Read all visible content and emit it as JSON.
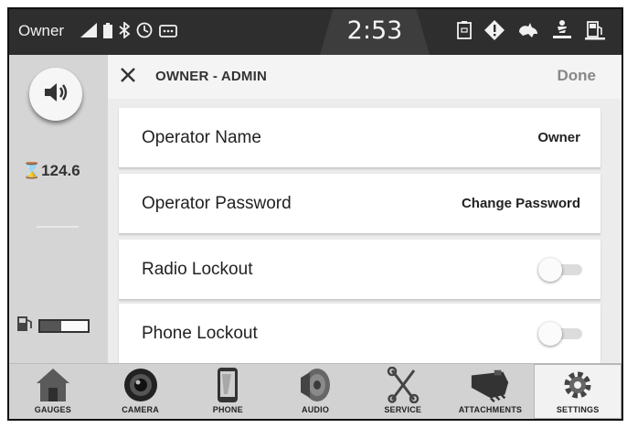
{
  "status_bar": {
    "owner_label": "Owner",
    "clock": "2:53",
    "left_icons": [
      "signal-icon",
      "battery-icon",
      "bluetooth-icon",
      "clock-icon",
      "message-icon"
    ],
    "right_icons": [
      "document-icon",
      "warning-icon",
      "speed-icon",
      "seatbelt-icon",
      "fuel-icon"
    ]
  },
  "left_rail": {
    "hours_icon": "⌛",
    "hours": "124.6",
    "fuel_level": 0.45
  },
  "header": {
    "title": "OWNER - ADMIN",
    "done_label": "Done"
  },
  "settings": [
    {
      "label": "Operator Name",
      "value": "Owner"
    },
    {
      "label": "Operator Password",
      "value": "Change Password"
    },
    {
      "label": "Radio Lockout",
      "toggle": false
    },
    {
      "label": "Phone Lockout",
      "toggle": false
    }
  ],
  "nav": [
    {
      "label": "GAUGES",
      "icon": "house-icon",
      "active": false
    },
    {
      "label": "CAMERA",
      "icon": "camera-icon",
      "active": false
    },
    {
      "label": "PHONE",
      "icon": "phone-icon",
      "active": false
    },
    {
      "label": "AUDIO",
      "icon": "speaker-icon",
      "active": false
    },
    {
      "label": "SERVICE",
      "icon": "wrench-icon",
      "active": false
    },
    {
      "label": "ATTACHMENTS",
      "icon": "bucket-icon",
      "active": false
    },
    {
      "label": "SETTINGS",
      "icon": "gear-icon",
      "active": true
    }
  ]
}
